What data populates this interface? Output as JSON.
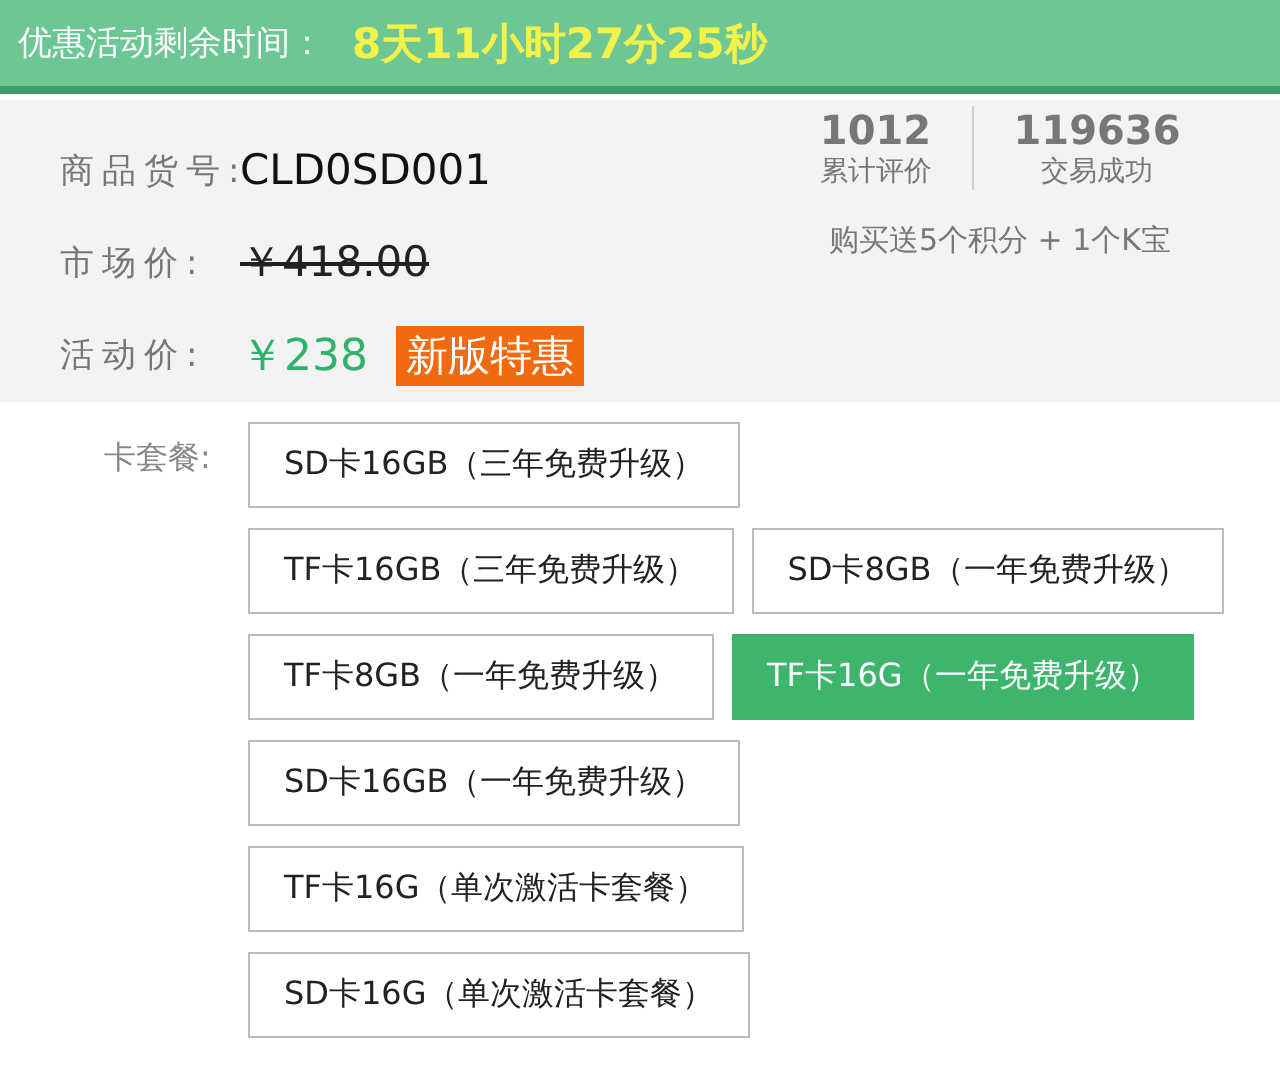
{
  "promo_banner": {
    "label": "优惠活动剩余时间：",
    "countdown": "8天11小时27分25秒"
  },
  "product": {
    "fields": [
      {
        "label": "商品货号:",
        "value": "CLD0SD001",
        "kind": "code"
      },
      {
        "label": "市场价:",
        "value": "￥418.00",
        "kind": "old-price"
      },
      {
        "label": "活动价:",
        "value": "￥238",
        "kind": "price",
        "badge": "新版特惠"
      }
    ],
    "stats": [
      {
        "value": "1012",
        "caption": "累计评价"
      },
      {
        "value": "119636",
        "caption": "交易成功"
      }
    ],
    "reward_note": "购买送5个积分 + 1个K宝"
  },
  "package": {
    "label": "卡套餐:",
    "option_rows": [
      [
        {
          "label": "SD卡16GB（三年免费升级）",
          "selected": false
        }
      ],
      [
        {
          "label": "TF卡16GB（三年免费升级）",
          "selected": false
        },
        {
          "label": "SD卡8GB（一年免费升级）",
          "selected": false
        }
      ],
      [
        {
          "label": "TF卡8GB（一年免费升级）",
          "selected": false
        },
        {
          "label": "TF卡16G（一年免费升级）",
          "selected": true
        }
      ],
      [
        {
          "label": "SD卡16GB（一年免费升级）",
          "selected": false
        }
      ],
      [
        {
          "label": "TF卡16G（单次激活卡套餐）",
          "selected": false
        }
      ],
      [
        {
          "label": "SD卡16G（单次激活卡套餐）",
          "selected": false
        }
      ]
    ]
  }
}
